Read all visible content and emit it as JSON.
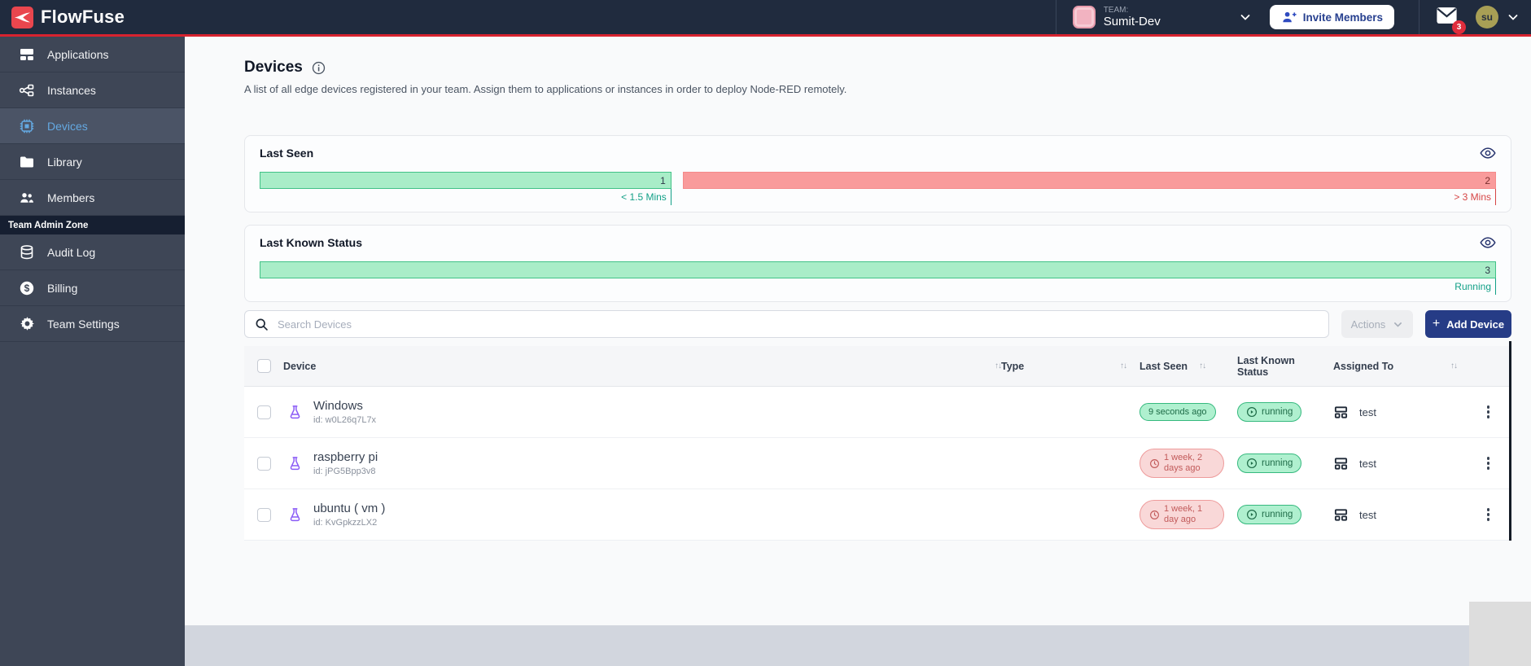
{
  "brand": {
    "name": "FlowFuse",
    "accent_red": "#D8232F"
  },
  "navbar": {
    "team_label": "TEAM:",
    "team_name": "Sumit-Dev",
    "invite_button_label": "Invite Members",
    "mail_badge_count": "3",
    "avatar_initials": "su"
  },
  "sidebar": {
    "items": [
      {
        "label": "Applications",
        "icon": "applications-icon",
        "selected": false
      },
      {
        "label": "Instances",
        "icon": "instances-icon",
        "selected": false
      },
      {
        "label": "Devices",
        "icon": "devices-icon",
        "selected": true
      },
      {
        "label": "Library",
        "icon": "library-icon",
        "selected": false
      },
      {
        "label": "Members",
        "icon": "members-icon",
        "selected": false
      }
    ],
    "admin_zone_label": "Team Admin Zone",
    "admin_items": [
      {
        "label": "Audit Log",
        "icon": "audit-log-icon"
      },
      {
        "label": "Billing",
        "icon": "billing-icon"
      },
      {
        "label": "Team Settings",
        "icon": "team-settings-icon"
      }
    ]
  },
  "page": {
    "title": "Devices",
    "description": "A list of all edge devices registered in your team. Assign them to applications or instances in order to deploy Node-RED remotely."
  },
  "last_seen_panel": {
    "title": "Last Seen",
    "segments": [
      {
        "value": "1",
        "label": "< 1.5 Mins",
        "fill": "#A9EDC8",
        "border": "#41C287",
        "label_color": "#12A087",
        "width_pct": 33.3
      },
      {
        "value": "2",
        "label": "> 3 Mins",
        "fill": "#F99B9B",
        "border": "#F58A8A",
        "label_color": "#D64545",
        "width_pct": 66.7
      }
    ]
  },
  "status_panel": {
    "title": "Last Known Status",
    "segments": [
      {
        "value": "3",
        "label": "Running",
        "fill": "#A9EDC8",
        "border": "#41C287",
        "label_color": "#12A087",
        "width_pct": 100
      }
    ]
  },
  "toolbar": {
    "search_placeholder": "Search Devices",
    "actions_label": "Actions",
    "add_device_label": "Add Device"
  },
  "table": {
    "headers": {
      "device": "Device",
      "type": "Type",
      "last_seen": "Last Seen",
      "last_known_status": "Last Known Status",
      "assigned_to": "Assigned To"
    },
    "rows": [
      {
        "name": "Windows",
        "id": "id: w0L26q7L7x",
        "last_seen": "9 seconds ago",
        "last_seen_variant": "ok",
        "status": "running",
        "assigned_to": "test"
      },
      {
        "name": "raspberry pi",
        "id": "id: jPG5Bpp3v8",
        "last_seen": "1 week, 2 days ago",
        "last_seen_variant": "overdue",
        "status": "running",
        "assigned_to": "test"
      },
      {
        "name": "ubuntu ( vm )",
        "id": "id: KvGpkzzLX2",
        "last_seen": "1 week, 1 day ago",
        "last_seen_variant": "overdue",
        "status": "running",
        "assigned_to": "test"
      }
    ]
  }
}
